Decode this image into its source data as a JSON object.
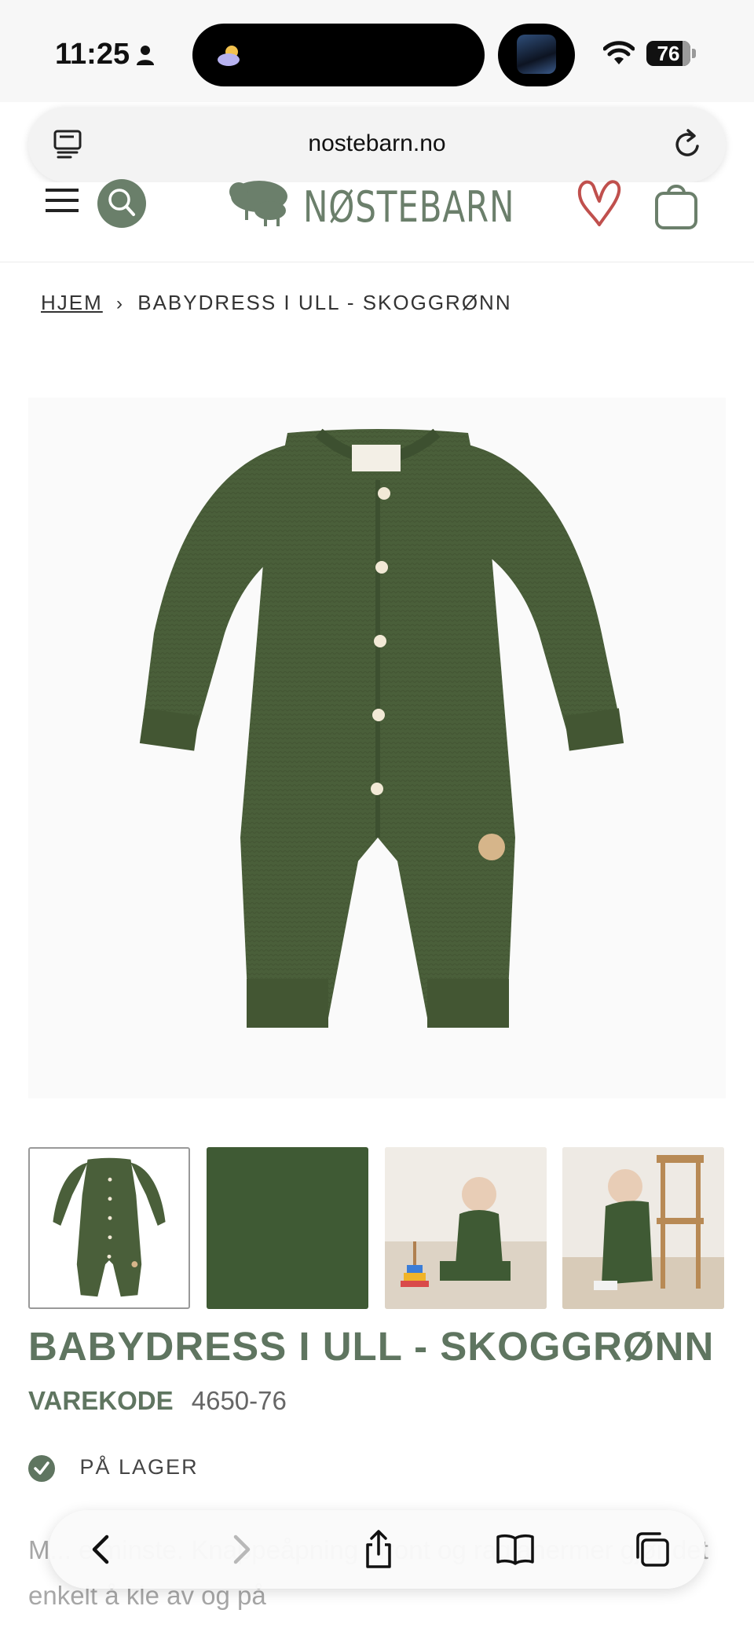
{
  "status_bar": {
    "time": "11:25",
    "battery": "76"
  },
  "browser": {
    "url": "nostebarn.no"
  },
  "header": {
    "logo_text": "NØSTEBARN"
  },
  "breadcrumb": {
    "home": "HJEM",
    "current": "BABYDRESS I ULL - SKOGGRØNN"
  },
  "product": {
    "title": "BABYDRESS I ULL - SKOGGRØNN",
    "sku_label": "VAREKODE",
    "sku_value": "4650-76",
    "stock": "PÅ LAGER",
    "description": "M... e minste. Knappeåpning i front og raglanermer gjør det enkelt å kle av og på",
    "color": "#4a5f3a"
  },
  "gallery": {
    "thumbnails": [
      "front",
      "fabric-closeup",
      "baby-sitting-toys",
      "baby-chair"
    ],
    "active_index": 0
  },
  "theme": {
    "brand_green": "#5f7560",
    "heart_red": "#c0504d"
  }
}
